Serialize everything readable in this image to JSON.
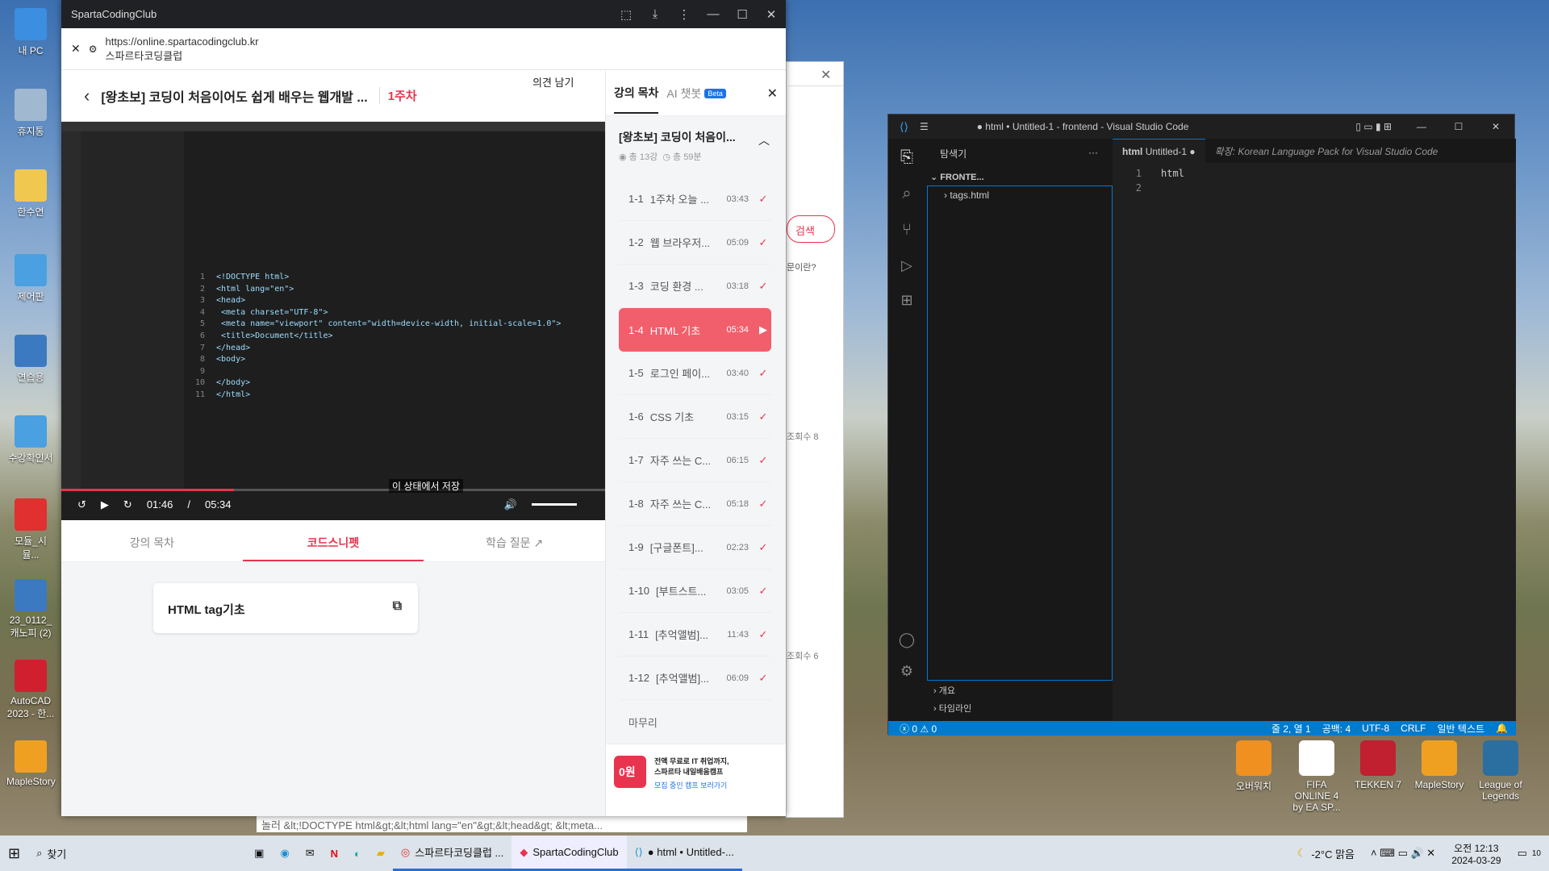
{
  "desktop_icons_left": [
    {
      "label": "내 PC"
    },
    {
      "label": "휴지통"
    },
    {
      "label": "한수연"
    },
    {
      "label": "제어판"
    },
    {
      "label": "연습용"
    },
    {
      "label": "수강확인서"
    },
    {
      "label": "모듈_시뮬..."
    },
    {
      "label": "23_0112_ 캐노피 (2)"
    },
    {
      "label": "AutoCAD 2023 - 한..."
    },
    {
      "label": "MapleStory"
    }
  ],
  "desktop_icons_right": [
    {
      "label": "오버워치"
    },
    {
      "label": "FIFA ONLINE 4 by EA SP..."
    },
    {
      "label": "TEKKEN 7"
    },
    {
      "label": "MapleStory"
    },
    {
      "label": "League of Legends"
    }
  ],
  "browser": {
    "window_title": "SpartaCodingClub",
    "url": "https://online.spartacodingclub.kr",
    "site_name": "스파르타코딩클럽",
    "course_title": "[왕초보] 코딩이 처음이어도 쉽게 배우는 웹개발 ...",
    "week": "1주차",
    "feedback_btn": "의견 남기",
    "video": {
      "current": "01:46",
      "sep": "/",
      "total": "05:34",
      "progress": 0.317,
      "caption": "이 상태에서 저장",
      "code_lines": [
        {
          "n": "1",
          "t": "<!DOCTYPE html>"
        },
        {
          "n": "2",
          "t": "<html lang=\"en\">"
        },
        {
          "n": "3",
          "t": "<head>"
        },
        {
          "n": "4",
          "t": "    <meta charset=\"UTF-8\">"
        },
        {
          "n": "5",
          "t": "    <meta name=\"viewport\" content=\"width=device-width, initial-scale=1.0\">"
        },
        {
          "n": "6",
          "t": "    <title>Document</title>"
        },
        {
          "n": "7",
          "t": "</head>"
        },
        {
          "n": "8",
          "t": "<body>"
        },
        {
          "n": "9",
          "t": ""
        },
        {
          "n": "10",
          "t": "</body>"
        },
        {
          "n": "11",
          "t": "</html>"
        }
      ]
    },
    "tabs": [
      "강의 목차",
      "코드스니펫",
      "학습 질문"
    ],
    "active_tab": "코드스니펫",
    "snippet_title": "HTML tag기초"
  },
  "panel": {
    "tab_toc": "강의 목차",
    "tab_ai": "AI 챗봇",
    "beta": "Beta",
    "course": "[왕초보] 코딩이 처음이...",
    "count": "총 13강",
    "duration": "총 59분",
    "lessons": [
      {
        "num": "1-1",
        "title": "1주차 오늘 ...",
        "dur": "03:43",
        "done": true
      },
      {
        "num": "1-2",
        "title": "웹 브라우저...",
        "dur": "05:09",
        "done": true
      },
      {
        "num": "1-3",
        "title": "코딩 환경 ...",
        "dur": "03:18",
        "done": true
      },
      {
        "num": "1-4",
        "title": "HTML 기초",
        "dur": "05:34",
        "done": false,
        "active": true
      },
      {
        "num": "1-5",
        "title": "로그인 페이...",
        "dur": "03:40",
        "done": true
      },
      {
        "num": "1-6",
        "title": "CSS 기초",
        "dur": "03:15",
        "done": true
      },
      {
        "num": "1-7",
        "title": "자주 쓰는 C...",
        "dur": "06:15",
        "done": true
      },
      {
        "num": "1-8",
        "title": "자주 쓰는 C...",
        "dur": "05:18",
        "done": true
      },
      {
        "num": "1-9",
        "title": "[구글폰트]...",
        "dur": "02:23",
        "done": true
      },
      {
        "num": "1-10",
        "title": "[부트스트...",
        "dur": "03:05",
        "done": true
      },
      {
        "num": "1-11",
        "title": "[추억앨범]...",
        "dur": "11:43",
        "done": true
      },
      {
        "num": "1-12",
        "title": "[추억앨범]...",
        "dur": "06:09",
        "done": true
      }
    ],
    "final": "마무리",
    "banner_line1": "전액 무료로 IT 취업까지,",
    "banner_line2": "스파르타 내일배움캠프",
    "banner_link": "모집 중인 캠프 보러가기",
    "banner_badge": "0원"
  },
  "behind": {
    "search": "검색",
    "q": "문이란?",
    "views1": "조회수 8",
    "views2": "조회수 6",
    "bottom": "놀러 &lt;!DOCTYPE html&gt;&lt;html lang=\"en\"&gt;&lt;head&gt; &lt;meta..."
  },
  "vscode": {
    "title": "● html • Untitled-1 - frontend - Visual Studio Code",
    "explorer": "탐색기",
    "folder": "FRONTE...",
    "file": "tags.html",
    "tab1_lang": "html",
    "tab1": "Untitled-1",
    "tab2": "확장: Korean Language Pack for Visual Studio Code",
    "lines": [
      {
        "n": "1",
        "t": "html"
      },
      {
        "n": "2",
        "t": ""
      }
    ],
    "outline": "개요",
    "timeline": "타임라인",
    "status": {
      "errors": "0",
      "warnings": "0",
      "pos": "줄 2, 열 1",
      "spaces": "공백: 4",
      "enc": "UTF-8",
      "eol": "CRLF",
      "lang": "일반 텍스트"
    }
  },
  "taskbar": {
    "search": "찾기",
    "items": [
      "스파르타코딩클럽 ...",
      "SpartaCodingClub",
      "● html • Untitled-..."
    ],
    "weather": "-2°C 맑음",
    "time": "오전 12:13",
    "date": "2024-03-29",
    "notif": "10"
  }
}
